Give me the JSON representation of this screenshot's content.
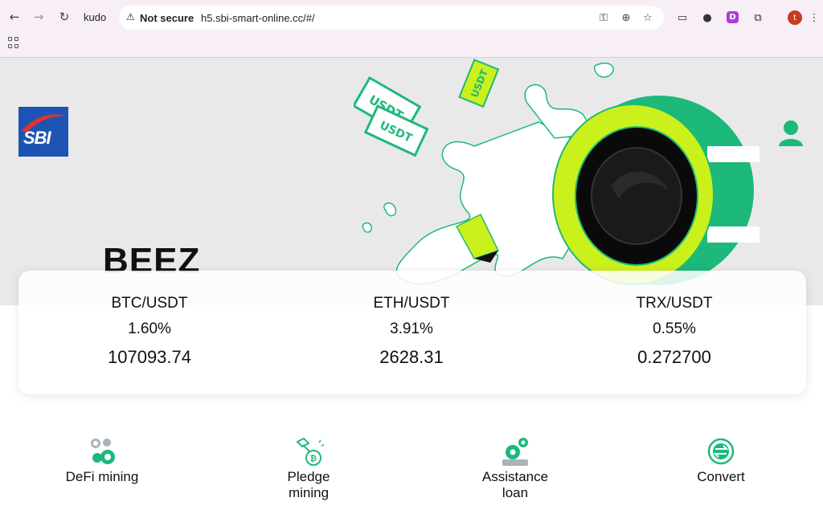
{
  "browser": {
    "tab_title": "kudo",
    "security_label": "Not secure",
    "url": "h5.sbi-smart-online.cc/#/",
    "profile_initial": "t"
  },
  "header": {
    "logo_text": "SBI",
    "brand": "BEEZ"
  },
  "hero_art": {
    "bill_label": "USDT"
  },
  "tickers": [
    {
      "pair": "BTC/USDT",
      "change": "1.60%",
      "price": "107093.74"
    },
    {
      "pair": "ETH/USDT",
      "change": "3.91%",
      "price": "2628.31"
    },
    {
      "pair": "TRX/USDT",
      "change": "0.55%",
      "price": "0.272700"
    }
  ],
  "features": [
    {
      "label": "DeFi mining",
      "icon": "defi-mining-icon"
    },
    {
      "label": "Pledge mining",
      "icon": "pledge-mining-icon"
    },
    {
      "label": "Assistance loan",
      "icon": "assistance-loan-icon"
    },
    {
      "label": "Convert",
      "icon": "convert-icon"
    }
  ],
  "colors": {
    "accent_green": "#1db97a",
    "lime": "#cbf11d",
    "logo_blue": "#1d54b4",
    "hero_bg": "#e9e9ea"
  }
}
